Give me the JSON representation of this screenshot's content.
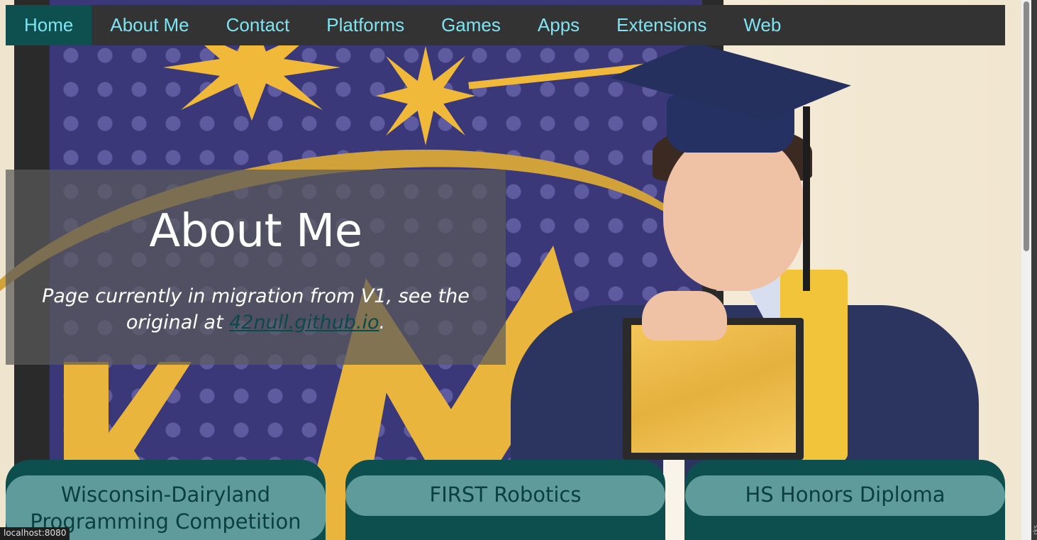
{
  "nav": {
    "items": [
      {
        "label": "Home",
        "active": true
      },
      {
        "label": "About Me",
        "active": false
      },
      {
        "label": "Contact",
        "active": false
      },
      {
        "label": "Platforms",
        "active": false
      },
      {
        "label": "Games",
        "active": false
      },
      {
        "label": "Apps",
        "active": false
      },
      {
        "label": "Extensions",
        "active": false
      },
      {
        "label": "Web",
        "active": false
      }
    ]
  },
  "hero": {
    "title": "About Me",
    "notice_prefix": "Page currently in migration from V1, see the original at ",
    "notice_link": "42null.github.io",
    "notice_suffix": "."
  },
  "cards": [
    {
      "title": "Wisconsin-Dairyland Programming Competition"
    },
    {
      "title": "FIRST Robotics"
    },
    {
      "title": "HS Honors Diploma"
    }
  ],
  "status": {
    "url": "localhost:8080"
  },
  "scrollbar": {
    "edge_text": "rks"
  },
  "colors": {
    "nav_bg": "#333333",
    "nav_text": "#7ee4f2",
    "nav_active": "#0e4f4f",
    "card_bg": "#0d4f4f",
    "card_title_bg": "#5f9b9a",
    "link": "#0b4a4a"
  }
}
